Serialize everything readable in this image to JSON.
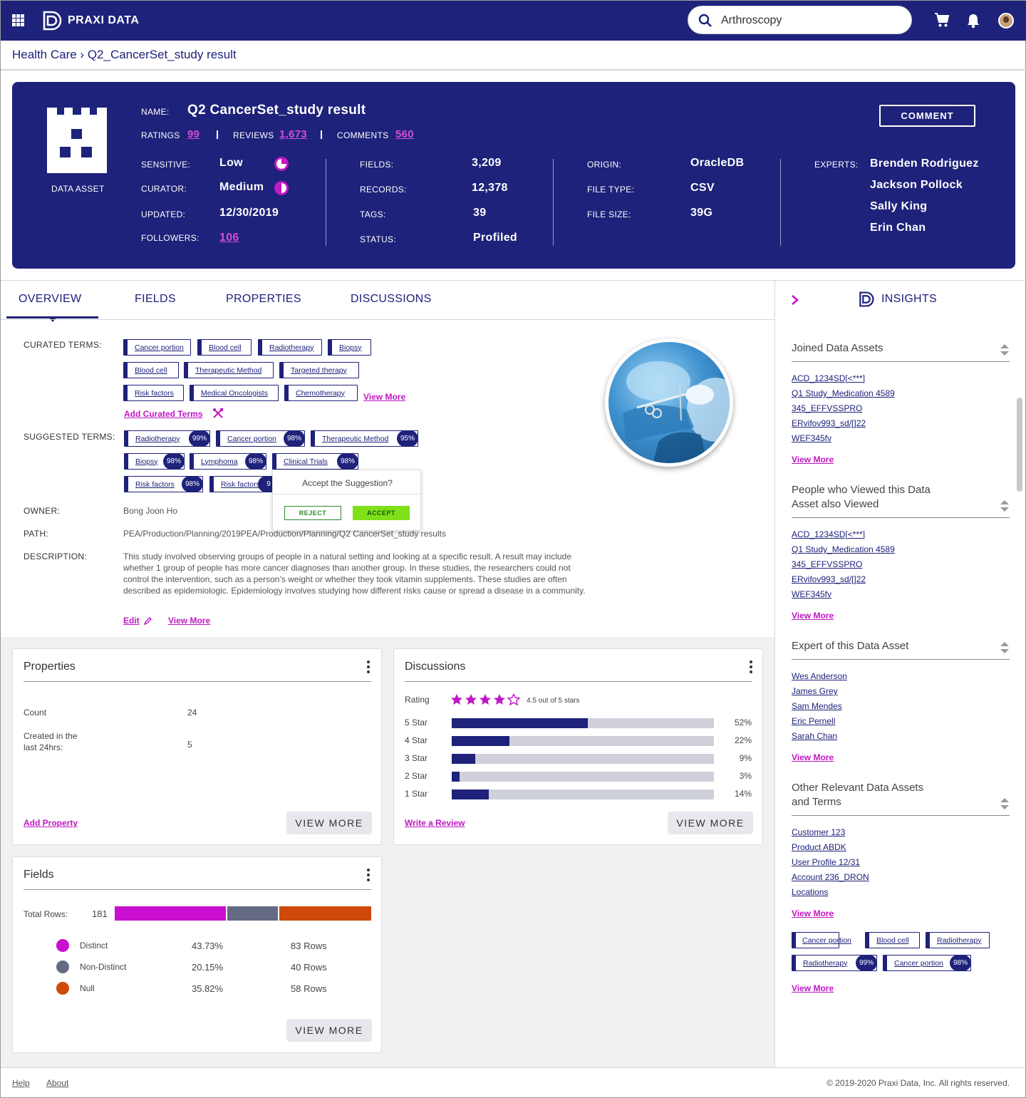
{
  "nav": {
    "brand": "PRAXI DATA",
    "search_value": "Arthroscopy"
  },
  "breadcrumb": "Health Care › Q2_CancerSet_study result",
  "asset": {
    "type_label": "DATA ASSET",
    "name_label": "NAME:",
    "name": "Q2 CancerSet_study result",
    "ratings_label": "RATINGS",
    "ratings": "99",
    "reviews_label": "REVIEWS",
    "reviews": "1,673",
    "comments_label": "COMMENTS",
    "comments": "560",
    "comment_button": "COMMENT",
    "sensitive_label": "SENSITIVE:",
    "sensitive": "Low",
    "curator_label": "CURATOR:",
    "curator": "Medium",
    "updated_label": "UPDATED:",
    "updated": "12/30/2019",
    "followers_label": "FOLLOWERS:",
    "followers": "106",
    "fields_label": "FIELDS:",
    "fields": "3,209",
    "records_label": "RECORDS:",
    "records": "12,378",
    "tags_label": "TAGS:",
    "tags": "39",
    "status_label": "STATUS:",
    "status": "Profiled",
    "origin_label": "ORIGIN:",
    "origin": "OracleDB",
    "filetype_label": "FILE TYPE:",
    "filetype": "CSV",
    "filesize_label": "FILE SIZE:",
    "filesize": "39G",
    "experts_label": "EXPERTS:",
    "experts": [
      "Brenden Rodriguez",
      "Jackson Pollock",
      "Sally King",
      "Erin Chan"
    ]
  },
  "tabs": [
    "OVERVIEW",
    "FIELDS",
    "PROPERTIES",
    "DISCUSSIONS"
  ],
  "overview": {
    "curated_label": "CURATED TERMS:",
    "curated": [
      "Cancer portion",
      "Blood cell",
      "Radiotherapy",
      "Biopsy",
      "Blood cell",
      "Therapeutic Method",
      "Targeted therapy",
      "Risk factors",
      "Medical Oncologists",
      "Chemotherapy"
    ],
    "view_more": "View More",
    "add_curated": "Add Curated Terms",
    "suggested_label": "SUGGESTED TERMS:",
    "suggested": [
      {
        "term": "Radiotherapy",
        "pct": "99%"
      },
      {
        "term": "Cancer portion",
        "pct": "98%"
      },
      {
        "term": "Therapeutic Method",
        "pct": "95%"
      },
      {
        "term": "Biopsy",
        "pct": "98%"
      },
      {
        "term": "Lymphoma",
        "pct": "98%"
      },
      {
        "term": "Clinical Trials",
        "pct": "98%"
      },
      {
        "term": "Risk factors",
        "pct": "98%"
      },
      {
        "term": "Risk factors",
        "pct": "9"
      }
    ],
    "popup": {
      "question": "Accept the Suggestion?",
      "reject": "REJECT",
      "accept": "ACCEPT"
    },
    "owner_label": "OWNER:",
    "owner": "Bong Joon Ho",
    "path_label": "PATH:",
    "path": "PEA/Production/Planning/2019PEA/Production/Planning/Q2 CancerSet_study results",
    "description_label": "DESCRIPTION:",
    "description": "This study involved observing groups of people in a natural setting and looking at a specific result. A result may include whether 1 group of people has more cancer diagnoses than another group. In these studies, the researchers could not control the intervention, such as a person’s weight or whether they took vitamin supplements. These studies are often described as epidemiologic. Epidemiology involves studying how different risks cause or spread a disease in a community.",
    "edit": "Edit",
    "view_more2": "View More"
  },
  "properties_card": {
    "title": "Properties",
    "count_label": "Count",
    "count": "24",
    "created_label": "Created in the last 24hrs:",
    "created": "5",
    "add": "Add Property",
    "view_more": "VIEW MORE"
  },
  "discussions_card": {
    "title": "Discussions",
    "rating_label": "Rating",
    "rating_text": "4.5 out of  5 stars",
    "rating": 4.5,
    "bars": [
      {
        "label": "5 Star",
        "pct": "52%",
        "value": 52
      },
      {
        "label": "4 Star",
        "pct": "22%",
        "value": 22
      },
      {
        "label": "3 Star",
        "pct": "9%",
        "value": 9
      },
      {
        "label": "2 Star",
        "pct": "3%",
        "value": 3
      },
      {
        "label": "1 Star",
        "pct": "14%",
        "value": 14
      }
    ],
    "write": "Write a Review",
    "view_more": "VIEW MORE"
  },
  "fields_card": {
    "title": "Fields",
    "total_label": "Total Rows:",
    "total": "181",
    "rows": [
      {
        "name": "Distinct",
        "pct": "43.73%",
        "rows": "83 Rows",
        "color": "#c90fcf",
        "share": 43.73
      },
      {
        "name": "Non-Distinct",
        "pct": "20.15%",
        "rows": "40 Rows",
        "color": "#646b82",
        "share": 20.15
      },
      {
        "name": "Null",
        "pct": "35.82%",
        "rows": "58 Rows",
        "color": "#cf4a0a",
        "share": 35.82
      }
    ],
    "view_more": "VIEW MORE"
  },
  "insights": {
    "title": "INSIGHTS",
    "sections": [
      {
        "title": "Joined Data Assets",
        "links": [
          "ACD_1234SD[<***]",
          "Q1 Study_Medication 4589",
          "345_EFFVSSPRO",
          "ERvifov993_sd/[]22",
          "WEF345fv"
        ]
      },
      {
        "title": "People who Viewed this Data Asset also Viewed",
        "links": [
          "ACD_1234SD[<***]",
          "Q1 Study_Medication 4589",
          "345_EFFVSSPRO",
          "ERvifov993_sd/[]22",
          "WEF345fv"
        ]
      },
      {
        "title": "Expert of this Data Asset",
        "links": [
          "Wes Anderson",
          "James Grey",
          "Sam Mendes",
          "Eric Pernell",
          "Sarah Chan"
        ]
      },
      {
        "title": "Other Relevant Data Assets and Terms",
        "links": [
          "Customer 123",
          "Product ABDK",
          "User Profile 12/31",
          "Account 236_DRON",
          "Locations"
        ]
      }
    ],
    "view_more": "View More",
    "terms": [
      "Cancer portion",
      "Blood cell",
      "Radiotherapy"
    ],
    "suggested": [
      {
        "term": "Radiotherapy",
        "pct": "99%"
      },
      {
        "term": "Cancer portion",
        "pct": "98%"
      }
    ]
  },
  "footer": {
    "help": "Help",
    "about": "About",
    "copyright": "© 2019-2020 Praxi Data, Inc. All rights reserved."
  },
  "colors": {
    "navy": "#1e227a",
    "accent": "#c016c4",
    "accept": "#7fe01a"
  }
}
